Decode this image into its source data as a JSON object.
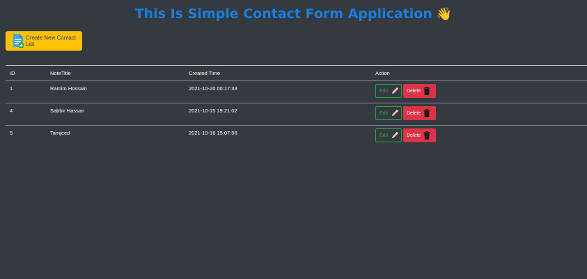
{
  "header": {
    "title": "This Is Simple Contact Form Application",
    "emoji": "👋"
  },
  "toolbar": {
    "create_label": "Create New Contact List",
    "create_icon": "add-document-icon"
  },
  "table": {
    "columns": [
      "ID",
      "NoteTitle",
      "Created Time",
      "Action"
    ],
    "rows": [
      {
        "id": "1",
        "title": "Ramim Hossain",
        "created": "2021-10-20 00:17:33"
      },
      {
        "id": "4",
        "title": "Sabbir Hassan",
        "created": "2021-10-15 19:21:02"
      },
      {
        "id": "5",
        "title": "Tamjeed",
        "created": "2021-10-16 15:07:56"
      }
    ],
    "edit_label": "Edit",
    "delete_label": "Delete",
    "edit_icon": "pencil-icon",
    "delete_icon": "trash-icon"
  },
  "colors": {
    "background": "#343a40",
    "title": "#1a7fe0",
    "create_button": "#ffc107",
    "edit_outline": "#28a745",
    "delete": "#dc3545"
  }
}
